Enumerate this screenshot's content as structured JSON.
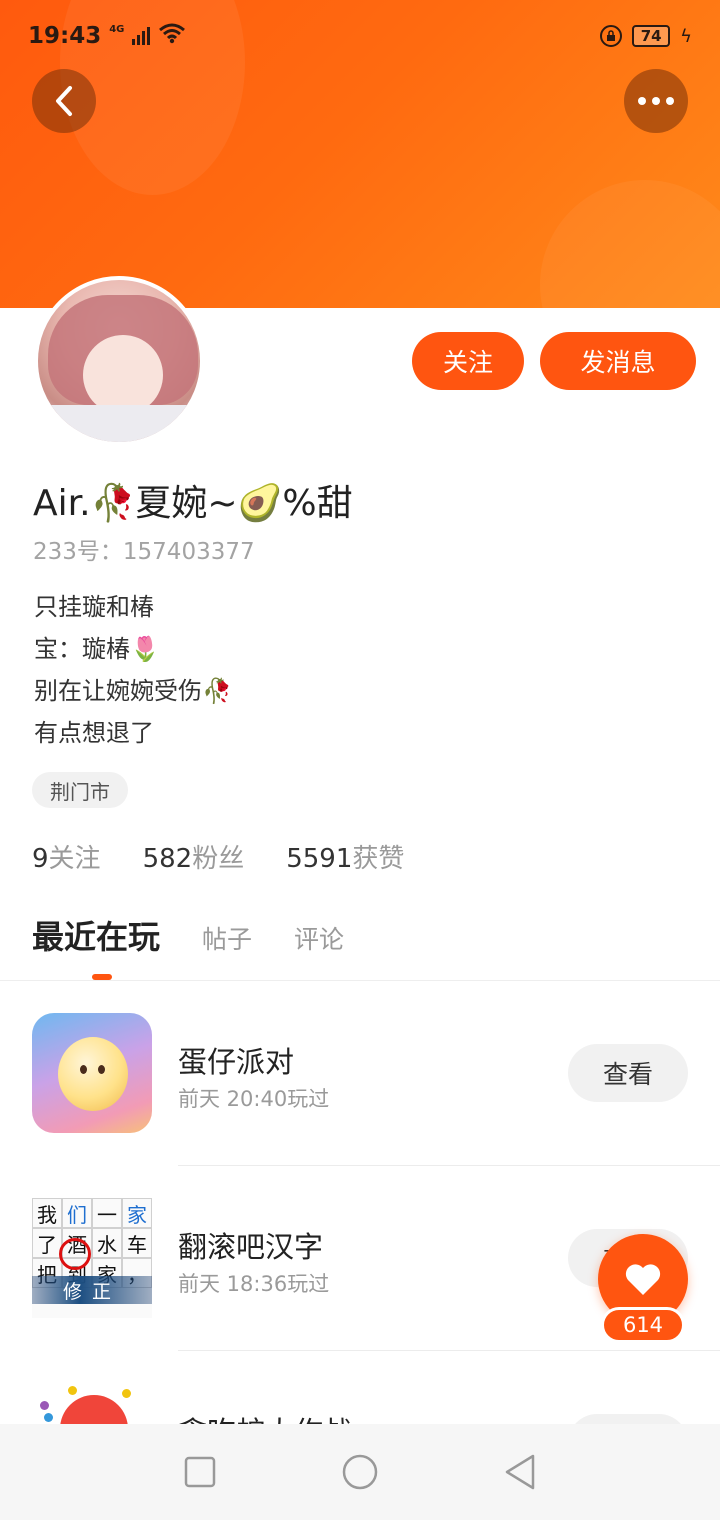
{
  "status_bar": {
    "time": "19:43",
    "network": "4G",
    "battery": "74"
  },
  "profile": {
    "username": "Air.🥀夏婉~🥑%甜",
    "uid_label": "233号：",
    "uid": "157403377",
    "bio_lines": [
      "只挂璇和椿",
      "宝：璇椿🌷",
      "别在让婉婉受伤🥀",
      "有点想退了"
    ],
    "location": "荆门市"
  },
  "actions": {
    "follow_label": "关注",
    "message_label": "发消息"
  },
  "stats": [
    {
      "num": "9",
      "label": "关注"
    },
    {
      "num": "582",
      "label": "粉丝"
    },
    {
      "num": "5591",
      "label": "获赞"
    }
  ],
  "tabs": [
    "最近在玩",
    "帖子",
    "评论"
  ],
  "games": [
    {
      "name": "蛋仔派对",
      "time": "前天 20:40玩过",
      "button": "查看"
    },
    {
      "name": "翻滚吧汉字",
      "time": "前天 18:36玩过",
      "button": "查看"
    },
    {
      "name": "贪吃蛇大作战",
      "time": "",
      "button": "查看"
    }
  ],
  "hanzi_icon": {
    "cells": [
      "我",
      "们",
      "一",
      "家",
      "了",
      "酒",
      "水",
      "车",
      "把",
      "到",
      "家",
      "，"
    ],
    "banner": "修正"
  },
  "like": {
    "count": "614"
  },
  "colors": {
    "accent": "#ff5510",
    "header_start": "#ff5a0e",
    "header_end": "#ff8a1a"
  }
}
